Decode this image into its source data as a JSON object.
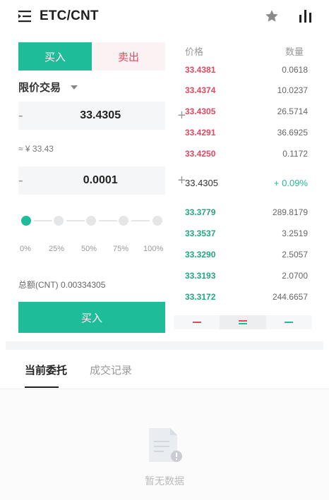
{
  "header": {
    "pair": "ETC/CNT",
    "icons": {
      "menu": "menu-icon",
      "favorite": "star-icon",
      "chart": "chart-icon"
    }
  },
  "trade": {
    "tab_buy": "买入",
    "tab_sell": "卖出",
    "order_type": "限价交易",
    "price": "33.4305",
    "approx": "≈ ¥ 33.43",
    "amount": "0.0001",
    "minus": "-",
    "plus": "+",
    "slider_value": 0,
    "percent_labels": [
      "0%",
      "25%",
      "50%",
      "75%",
      "100%"
    ],
    "total": "总额(CNT) 0.00334305",
    "submit": "买入"
  },
  "orderbook": {
    "price_header": "价格",
    "qty_header": "数量",
    "asks": [
      {
        "price": "33.4381",
        "qty": "0.0618"
      },
      {
        "price": "33.4374",
        "qty": "10.0237"
      },
      {
        "price": "33.4305",
        "qty": "26.5714"
      },
      {
        "price": "33.4291",
        "qty": "36.6925"
      },
      {
        "price": "33.4250",
        "qty": "0.1172"
      }
    ],
    "mid_price": "33.4305",
    "mid_change": "+ 0.09%",
    "bids": [
      {
        "price": "33.3779",
        "qty": "289.8179"
      },
      {
        "price": "33.3537",
        "qty": "3.2519"
      },
      {
        "price": "33.3290",
        "qty": "2.5057"
      },
      {
        "price": "33.3193",
        "qty": "2.0700"
      },
      {
        "price": "33.3172",
        "qty": "244.6657"
      }
    ]
  },
  "orders": {
    "tab_current": "当前委托",
    "tab_history": "成交记录",
    "empty_text": "暂无数据"
  },
  "colors": {
    "buy": "#1ebc99",
    "sell": "#e2485f",
    "bid_price": "#1ea883"
  }
}
